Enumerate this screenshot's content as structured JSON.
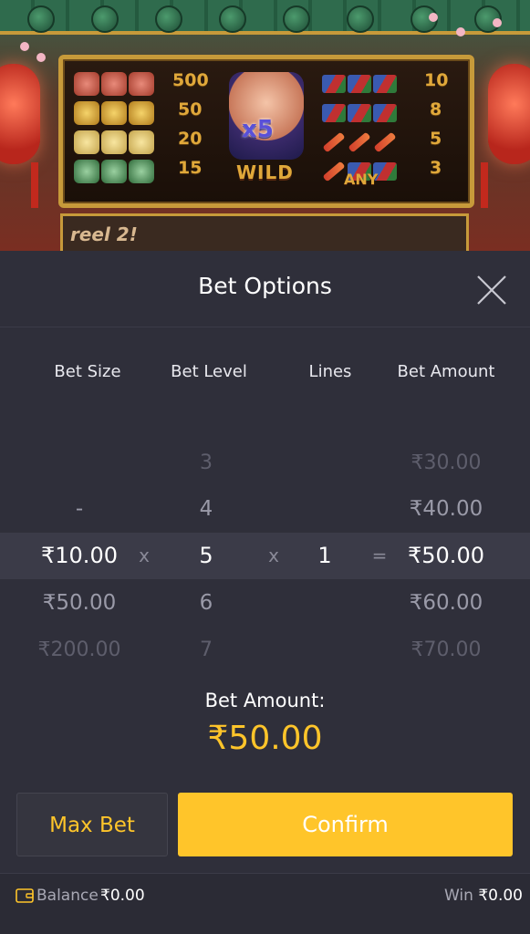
{
  "game": {
    "paytable": {
      "left_payouts": [
        "500",
        "50",
        "20",
        "15"
      ],
      "wild_multiplier": "x5",
      "wild_label": "WILD",
      "any_label": "ANY",
      "right_payouts": [
        "10",
        "8",
        "5",
        "3"
      ]
    },
    "reel_text": "reel 2!"
  },
  "bet_options": {
    "title": "Bet Options",
    "columns": {
      "bet_size": "Bet Size",
      "bet_level": "Bet Level",
      "lines": "Lines",
      "bet_amount": "Bet Amount"
    },
    "rows": [
      {
        "bet_size": "",
        "bet_level": "3",
        "lines": "",
        "bet_amount": "₹30.00",
        "dim": "faint"
      },
      {
        "bet_size": "-",
        "bet_level": "4",
        "lines": "",
        "bet_amount": "₹40.00",
        "dim": "mid"
      },
      {
        "bet_size": "₹10.00",
        "bet_level": "5",
        "lines": "1",
        "bet_amount": "₹50.00",
        "dim": "selected"
      },
      {
        "bet_size": "₹50.00",
        "bet_level": "6",
        "lines": "",
        "bet_amount": "₹60.00",
        "dim": "mid"
      },
      {
        "bet_size": "₹200.00",
        "bet_level": "7",
        "lines": "",
        "bet_amount": "₹70.00",
        "dim": "faint"
      }
    ],
    "operators": {
      "times": "x",
      "equals": "="
    },
    "bet_amount_label": "Bet Amount:",
    "bet_amount_value": "₹50.00",
    "max_bet_label": "Max Bet",
    "confirm_label": "Confirm"
  },
  "footer": {
    "balance_label": "Balance",
    "balance_value": "₹0.00",
    "win_label": "Win",
    "win_value": "₹0.00"
  },
  "colors": {
    "accent": "#ffc52a",
    "panel_bg": "#2f2f3a",
    "selected_row": "#3b3b48"
  }
}
